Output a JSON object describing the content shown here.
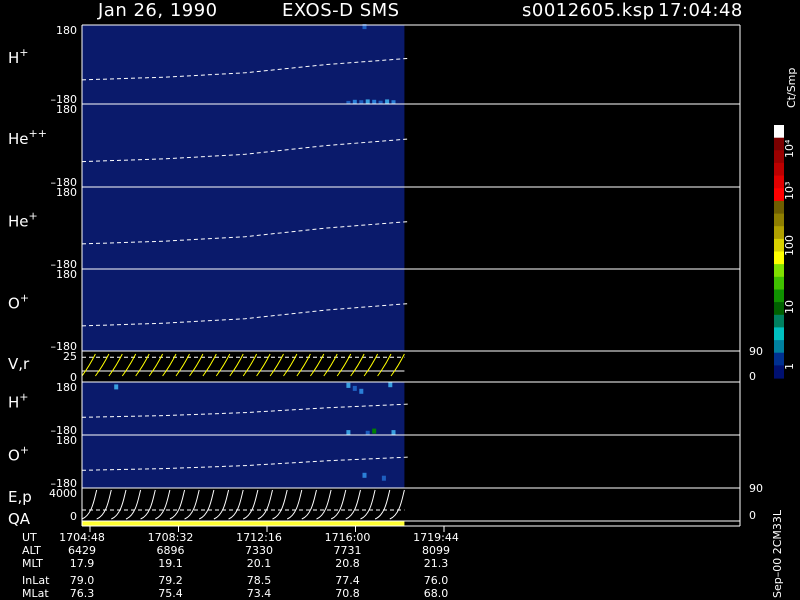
{
  "header": {
    "date": "Jan 26, 1990",
    "instrument": "EXOS-D SMS",
    "file": "s0012605.ksp",
    "time": "17:04:48"
  },
  "colorbar": {
    "unit": "Ct/Smp",
    "labels": [
      "10⁴",
      "10³",
      "100",
      "10",
      "1"
    ],
    "colors": [
      "#ffffff",
      "#7a0000",
      "#9a0000",
      "#bb0000",
      "#e00000",
      "#ff0000",
      "#6e5e00",
      "#8e7e00",
      "#b0a000",
      "#d8d000",
      "#ffff00",
      "#80e000",
      "#40c000",
      "#109000",
      "#006000",
      "#008060",
      "#00c0c0",
      "#0080a0",
      "#003090",
      "#001070"
    ]
  },
  "colors": {
    "background": "#000000",
    "spectrogram_bg": "#0a1a6b",
    "qa_bar": "#ffff33",
    "vr_curves": "#ffff00"
  },
  "footer": {
    "row_labels": [
      "UT",
      "ALT",
      "MLT",
      "InLat",
      "MLat"
    ],
    "columns": [
      [
        "1704:48",
        "6429",
        "17.9",
        "79.0",
        "76.3"
      ],
      [
        "1708:32",
        "6896",
        "19.1",
        "79.2",
        "75.4"
      ],
      [
        "1712:16",
        "7330",
        "20.1",
        "78.5",
        "73.4"
      ],
      [
        "1716:00",
        "7731",
        "20.8",
        "77.4",
        "70.8"
      ],
      [
        "1719:44",
        "8099",
        "21.3",
        "76.0",
        "68.0"
      ]
    ],
    "stamp": "Sep–00 2CM33L"
  },
  "chart_data": [
    {
      "type": "heatmap",
      "panel": "H+",
      "label": "H",
      "label_sup": "+",
      "yticks": [
        "180",
        "–180"
      ],
      "ylim": [
        -180,
        180
      ],
      "data_x_fraction": [
        0,
        0.49
      ],
      "dashed_curve": [
        [
          0,
          -70
        ],
        [
          0.25,
          -58
        ],
        [
          0.5,
          -38
        ],
        [
          0.75,
          0
        ],
        [
          1,
          28
        ]
      ],
      "counts": [
        [
          0.82,
          -175,
          "#1e5fc0"
        ],
        [
          0.84,
          -170,
          "#2b80d8"
        ],
        [
          0.86,
          -172,
          "#1e5fc0"
        ],
        [
          0.88,
          -168,
          "#3aa0e0"
        ],
        [
          0.9,
          -170,
          "#2b80d8"
        ],
        [
          0.92,
          -174,
          "#1e5fc0"
        ],
        [
          0.94,
          -168,
          "#3aa0e0"
        ],
        [
          0.96,
          -172,
          "#2b80d8"
        ],
        [
          0.87,
          175,
          "#1e5fc0"
        ]
      ]
    },
    {
      "type": "heatmap",
      "panel": "He++",
      "label": "He",
      "label_sup": "++",
      "yticks": [
        "180",
        "–180"
      ],
      "ylim": [
        -180,
        180
      ],
      "data_x_fraction": [
        0,
        0.49
      ],
      "dashed_curve": [
        [
          0,
          -70
        ],
        [
          0.25,
          -58
        ],
        [
          0.5,
          -38
        ],
        [
          0.75,
          0
        ],
        [
          1,
          28
        ]
      ],
      "counts": []
    },
    {
      "type": "heatmap",
      "panel": "He+",
      "label": "He",
      "label_sup": "+",
      "yticks": [
        "180",
        "–180"
      ],
      "ylim": [
        -180,
        180
      ],
      "data_x_fraction": [
        0,
        0.49
      ],
      "dashed_curve": [
        [
          0,
          -70
        ],
        [
          0.25,
          -58
        ],
        [
          0.5,
          -38
        ],
        [
          0.75,
          0
        ],
        [
          1,
          28
        ]
      ],
      "counts": []
    },
    {
      "type": "heatmap",
      "panel": "O+",
      "label": "O",
      "label_sup": "+",
      "yticks": [
        "180",
        "–180"
      ],
      "ylim": [
        -180,
        180
      ],
      "data_x_fraction": [
        0,
        0.49
      ],
      "dashed_curve": [
        [
          0,
          -70
        ],
        [
          0.25,
          -58
        ],
        [
          0.5,
          -38
        ],
        [
          0.75,
          0
        ],
        [
          1,
          28
        ]
      ],
      "counts": []
    },
    {
      "type": "line",
      "panel": "V,r",
      "label": "V,r",
      "label_sup": "",
      "yticks": [
        "25",
        "0"
      ],
      "ylim": [
        0,
        25
      ],
      "right_ticks": [
        "90",
        "0"
      ],
      "data_x_fraction": [
        0,
        0.49
      ],
      "dashed_y": 20,
      "segment_count": 24
    },
    {
      "type": "heatmap",
      "panel": "H+ (lower)",
      "label": "H",
      "label_sup": "+",
      "yticks": [
        "180",
        "–180"
      ],
      "ylim": [
        -180,
        180
      ],
      "data_x_fraction": [
        0,
        0.49
      ],
      "dashed_curve": [
        [
          0,
          -60
        ],
        [
          0.25,
          -48
        ],
        [
          0.5,
          -28
        ],
        [
          0.75,
          5
        ],
        [
          1,
          30
        ]
      ],
      "counts": [
        [
          0.1,
          150,
          "#3aa0e0"
        ],
        [
          0.82,
          160,
          "#3aa0e0"
        ],
        [
          0.84,
          140,
          "#1e5fc0"
        ],
        [
          0.86,
          120,
          "#2b80d8"
        ],
        [
          0.95,
          165,
          "#3aa0e0"
        ],
        [
          0.82,
          -160,
          "#3aa0e0"
        ],
        [
          0.88,
          -165,
          "#1e5fc0"
        ],
        [
          0.9,
          -150,
          "#008000"
        ],
        [
          0.96,
          -160,
          "#3aa0e0"
        ]
      ]
    },
    {
      "type": "heatmap",
      "panel": "O+ (lower)",
      "label": "O",
      "label_sup": "+",
      "yticks": [
        "180",
        "–180"
      ],
      "ylim": [
        -180,
        180
      ],
      "data_x_fraction": [
        0,
        0.49
      ],
      "dashed_curve": [
        [
          0,
          -60
        ],
        [
          0.25,
          -48
        ],
        [
          0.5,
          -28
        ],
        [
          0.75,
          5
        ],
        [
          1,
          30
        ]
      ],
      "counts": [
        [
          0.87,
          -90,
          "#2b80d8"
        ],
        [
          0.93,
          -110,
          "#1e5fc0"
        ]
      ]
    },
    {
      "type": "line",
      "panel": "E,p",
      "label": "E,p",
      "label_sup": "",
      "yticks": [
        "4000",
        "0"
      ],
      "ylim": [
        0,
        4000
      ],
      "right_ticks": [
        "90",
        "0"
      ],
      "data_x_fraction": [
        0,
        0.49
      ],
      "segment_count": 22
    },
    {
      "type": "bar",
      "panel": "QA",
      "label": "QA",
      "label_sup": "",
      "data_x_fraction": [
        0,
        0.49
      ]
    }
  ]
}
